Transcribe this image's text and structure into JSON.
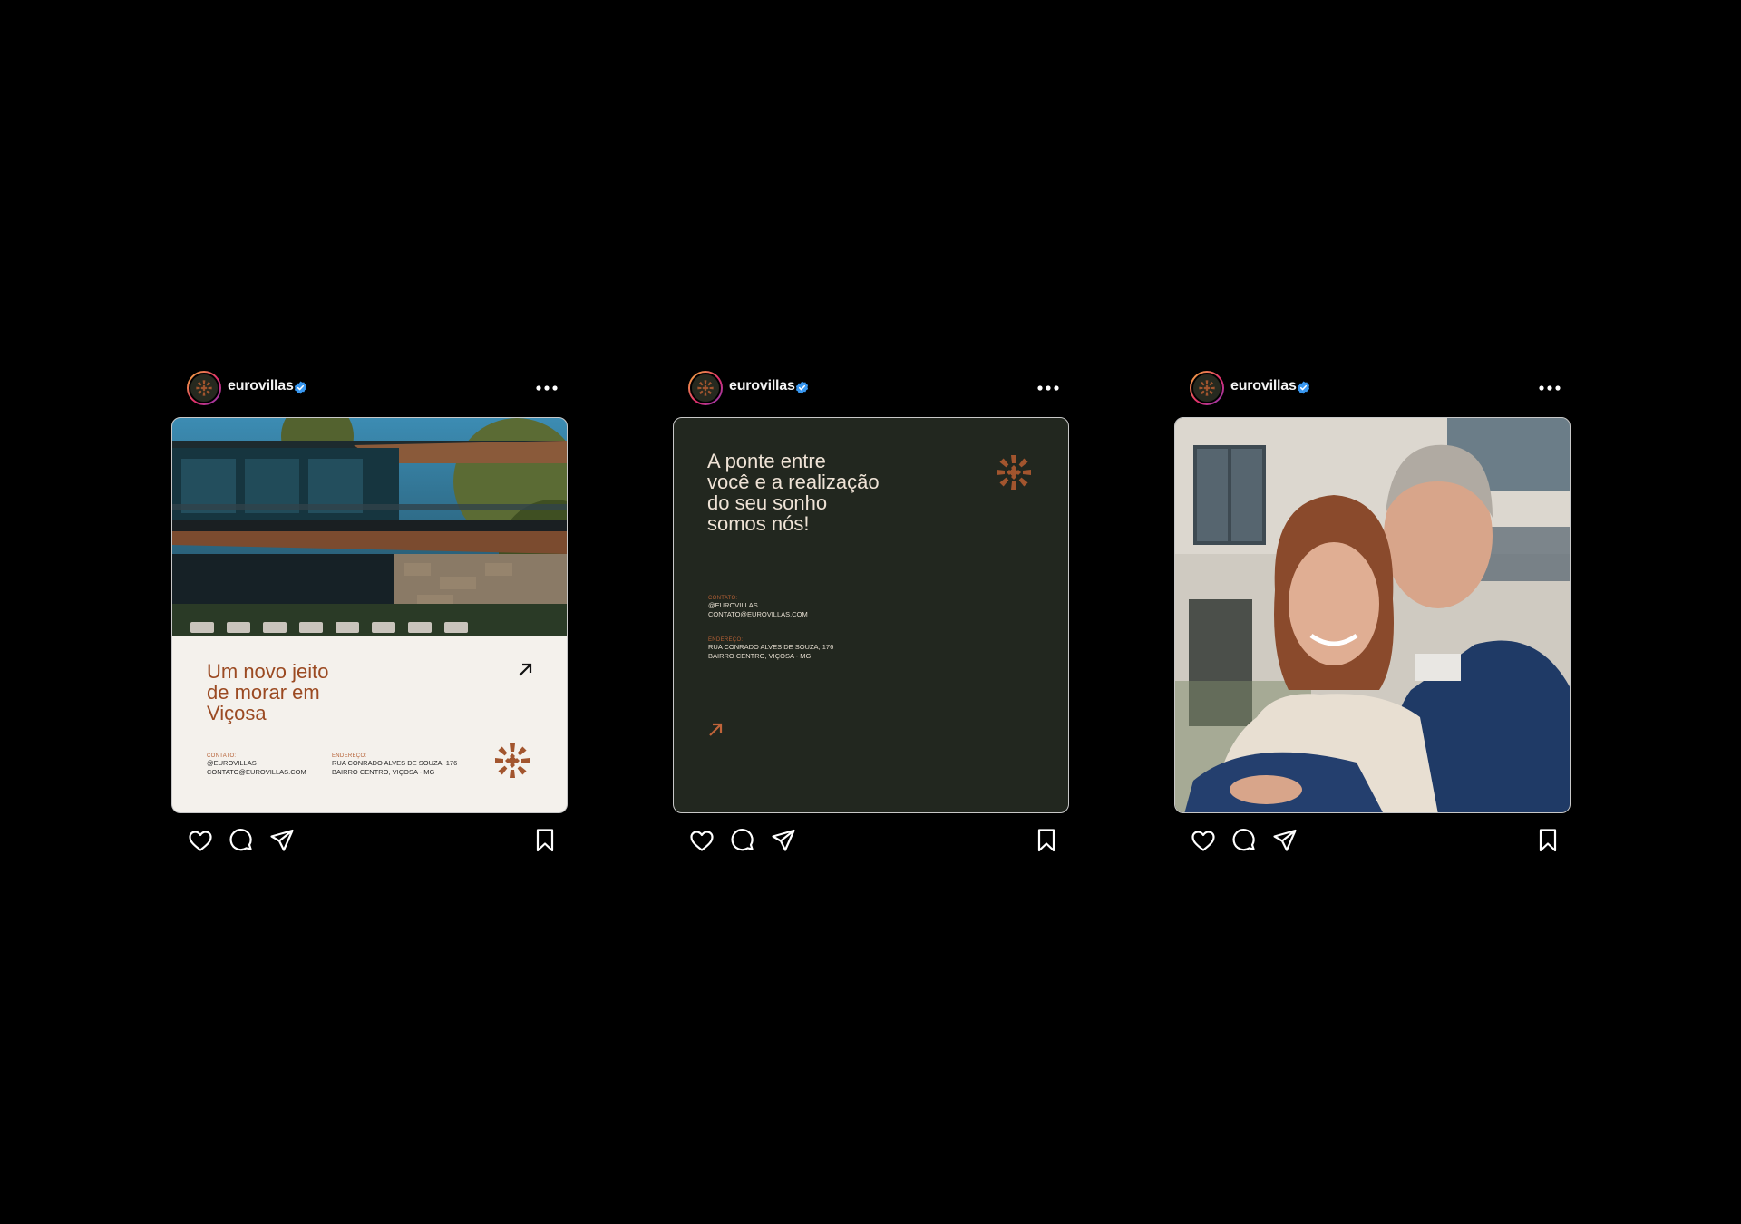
{
  "account": {
    "username": "eurovillas"
  },
  "colors": {
    "accent": "#9b4a22",
    "dark_green": "#22271f",
    "cream": "#f4f1ec",
    "verified": "#3897f0"
  },
  "posts": [
    {
      "title": "Um novo jeito\nde morar em\nViçosa",
      "contact_label": "CONTATO:",
      "contact_handle": "@EUROVILLAS",
      "contact_email": "CONTATO@EUROVILLAS.COM",
      "address_label": "ENDEREÇO:",
      "address_line1": "RUA CONRADO ALVES DE SOUZA, 176",
      "address_line2": "BAIRRO CENTRO, VIÇOSA - MG"
    },
    {
      "title": "A ponte entre\nvocê e a realização\ndo seu sonho\nsomos nós!",
      "contact_label": "CONTATO:",
      "contact_handle": "@EUROVILLAS",
      "contact_email": "CONTATO@EUROVILLAS.COM",
      "address_label": "ENDEREÇO:",
      "address_line1": "RUA CONRADO ALVES DE SOUZA, 176",
      "address_line2": "BAIRRO CENTRO, VIÇOSA - MG"
    },
    {}
  ],
  "icons": [
    "verified-badge-icon",
    "more-options-icon",
    "heart-icon",
    "comment-icon",
    "share-icon",
    "bookmark-icon",
    "arrow-up-right-icon",
    "sun-logo-icon"
  ]
}
